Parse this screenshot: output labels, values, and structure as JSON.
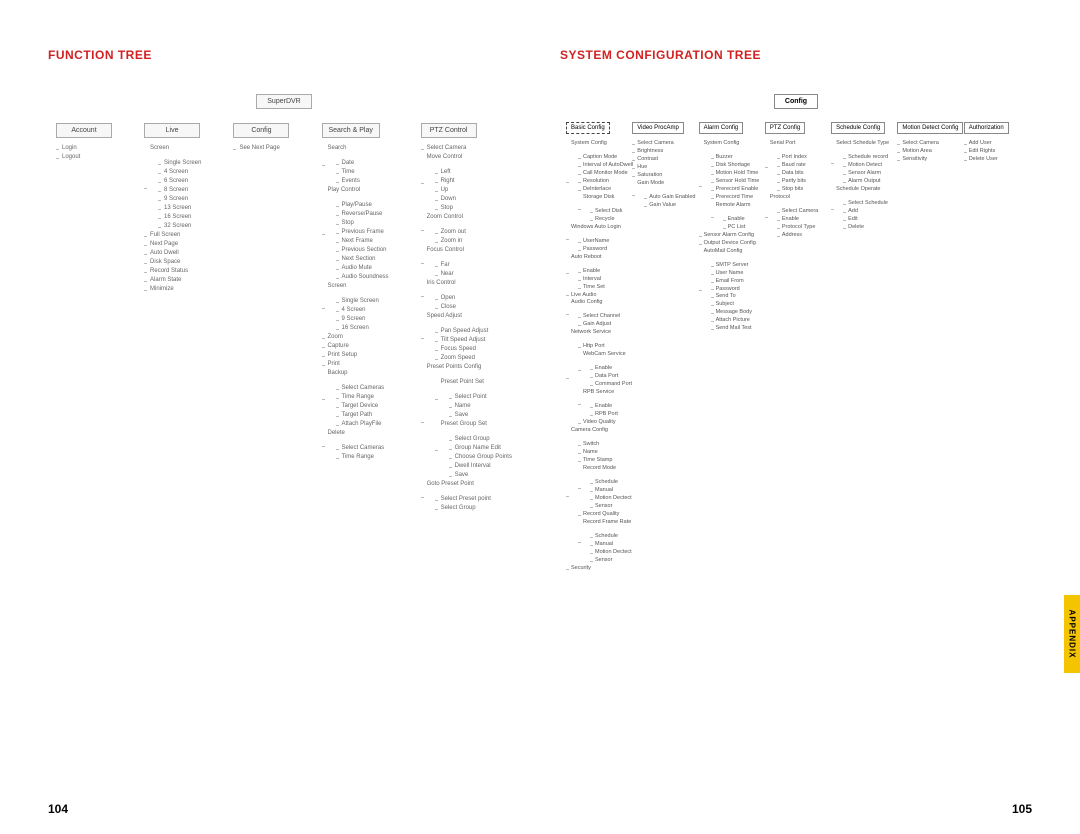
{
  "appendix_label": "APPENDIX",
  "left": {
    "title": "FUNCTION TREE",
    "page_num": "104",
    "root": "SuperDVR",
    "branches": [
      {
        "label": "Account",
        "items": [
          "Login",
          "Logout"
        ]
      },
      {
        "label": "Live",
        "items": [
          "Screen",
          {
            "sub": [
              "Single Screen",
              "4 Screen",
              "6 Screen",
              "8 Screen",
              "9 Screen",
              "13 Screen",
              "16 Screen",
              "32 Screen"
            ]
          },
          "Full Screen",
          "Next Page",
          "Auto Dwell",
          "Disk Space",
          "Record Status",
          "Alarm State",
          "Minimize"
        ]
      },
      {
        "label": "Config",
        "items": [
          "See Next Page"
        ]
      },
      {
        "label": "Search & Play",
        "items": [
          "Search",
          {
            "sub": [
              "Date",
              "Time",
              "Events"
            ]
          },
          "Play Control",
          {
            "sub": [
              "Play/Pause",
              "Reverse/Pause",
              "Stop",
              "Previous Frame",
              "Next Frame",
              "Previous Section",
              "Next Section",
              "Audio Mute",
              "Audio Soundness"
            ]
          },
          "Screen",
          {
            "sub": [
              "Single Screen",
              "4 Screen",
              "9 Screen",
              "16 Screen"
            ]
          },
          "Zoom",
          "Capture",
          "Print Setup",
          "Print",
          "Backup",
          {
            "sub": [
              "Select Cameras",
              "Time Range",
              "Target Device",
              "Target Path",
              "Attach PlayFile"
            ]
          },
          "Delete",
          {
            "sub": [
              "Select Cameras",
              "Time Range"
            ]
          }
        ]
      },
      {
        "label": "PTZ Control",
        "items": [
          "Select Camera",
          "Move Control",
          {
            "sub": [
              "Left",
              "Right",
              "Up",
              "Down",
              "Stop"
            ]
          },
          "Zoom Control",
          {
            "sub": [
              "Zoom out",
              "Zoom in"
            ]
          },
          "Focus Control",
          {
            "sub": [
              "Far",
              "Near"
            ]
          },
          "Iris Control",
          {
            "sub": [
              "Open",
              "Close"
            ]
          },
          "Speed Adjust",
          {
            "sub": [
              "Pan Speed Adjust",
              "Tilt Speed Adjust",
              "Focus Speed",
              "Zoom Speed"
            ]
          },
          "Preset Points Config",
          {
            "sub": [
              "Preset Point Set",
              {
                "sub2": [
                  "Select Point",
                  "Name",
                  "Save"
                ]
              },
              "Preset Group Set",
              {
                "sub2": [
                  "Select Group",
                  "Group Name Edit",
                  "Choose Group Points",
                  "Dwell Interval",
                  "Save"
                ]
              }
            ]
          },
          "Goto Preset Point",
          {
            "sub": [
              "Select Preset point",
              "Select Group"
            ]
          }
        ]
      }
    ]
  },
  "right": {
    "title": "SYSTEM CONFIGURATION TREE",
    "page_num": "105",
    "root": "Config",
    "branches": [
      {
        "label": "Basic Config",
        "dashed": true,
        "items": [
          "System Config",
          {
            "sub": [
              "Caption Mode",
              "Interval of AutoDwell",
              "Call Monitor Mode",
              "Resolution",
              "DeInterlace",
              "Storage Disk",
              {
                "sub2": [
                  "Select Disk",
                  "Recycle"
                ]
              }
            ]
          },
          "Windows Auto Login",
          {
            "sub": [
              "UserName",
              "Password"
            ]
          },
          "Auto Reboot",
          {
            "sub": [
              "Enable",
              "Interval",
              "Time Set"
            ]
          },
          "Live Audio",
          "Audio Config",
          {
            "sub": [
              "Select Channel",
              "Gain Adjust"
            ]
          },
          "Network Service",
          {
            "sub": [
              "Http Port",
              "WebCam Service",
              {
                "sub2": [
                  "Enable",
                  "Data Port",
                  "Command Port"
                ]
              },
              "RPB Service",
              {
                "sub2": [
                  "Enable",
                  "RPB Port"
                ]
              },
              "Video Quality"
            ]
          },
          "Camera Config",
          {
            "sub": [
              "Switch",
              "Name",
              "Time Stamp",
              "Record Mode",
              {
                "sub2": [
                  "Schedule",
                  "Manual",
                  "Motion Dectect",
                  "Sensor"
                ]
              },
              "Record Quality",
              "Record Frame Rate",
              {
                "sub2": [
                  "Schedule",
                  "Manual",
                  "Motion Dectect",
                  "Sensor"
                ]
              }
            ]
          },
          "Security"
        ]
      },
      {
        "label": "Video ProcAmp",
        "items": [
          "Select Camera",
          "Brightness",
          "Contrast",
          "Hue",
          "Saturation",
          "Gain Mode",
          {
            "sub": [
              "Auto Gain Enabled",
              "Gain Value"
            ]
          }
        ]
      },
      {
        "label": "Alarm Config",
        "items": [
          "System Config",
          {
            "sub": [
              "Buzzer",
              "Disk Shortage",
              "Motion Hold Time",
              "Sensor Hold Time",
              "Prerecord Enable",
              "Prerecord Time",
              "Remote Alarm",
              {
                "sub2": [
                  "Enable",
                  "PC List"
                ]
              }
            ]
          },
          "Sensor Alarm Config",
          "Output Device Config",
          "AutoMail Config",
          {
            "sub": [
              "SMTP Server",
              "User Name",
              "Email From",
              "Password",
              "Send To",
              "Subject",
              "Message Body",
              "Attach Picture",
              "Send Mail Test"
            ]
          }
        ]
      },
      {
        "label": "PTZ Config",
        "items": [
          "Serial Port",
          {
            "sub": [
              "Port Index",
              "Baud rate",
              "Data bits",
              "Parity bits",
              "Stop bits"
            ]
          },
          "Protocol",
          {
            "sub": [
              "Select Camera",
              "Enable",
              "Protocol Type",
              "Address"
            ]
          }
        ]
      },
      {
        "label": "Schedule Config",
        "items": [
          "Select Schedule Type",
          {
            "sub": [
              "Schedule record",
              "Motion Detect",
              "Sensor Alarm",
              "Alarm Output"
            ]
          },
          "Schedule Operate",
          {
            "sub": [
              "Select Schedule",
              "Add",
              "Edit",
              "Delete"
            ]
          }
        ]
      },
      {
        "label": "Motion Detect Config",
        "items": [
          "Select Camera",
          "Motion Area",
          "Sensitivity"
        ]
      },
      {
        "label": "Authorization",
        "items": [
          "Add User",
          "Edit Rights",
          "Delete User"
        ]
      }
    ]
  }
}
